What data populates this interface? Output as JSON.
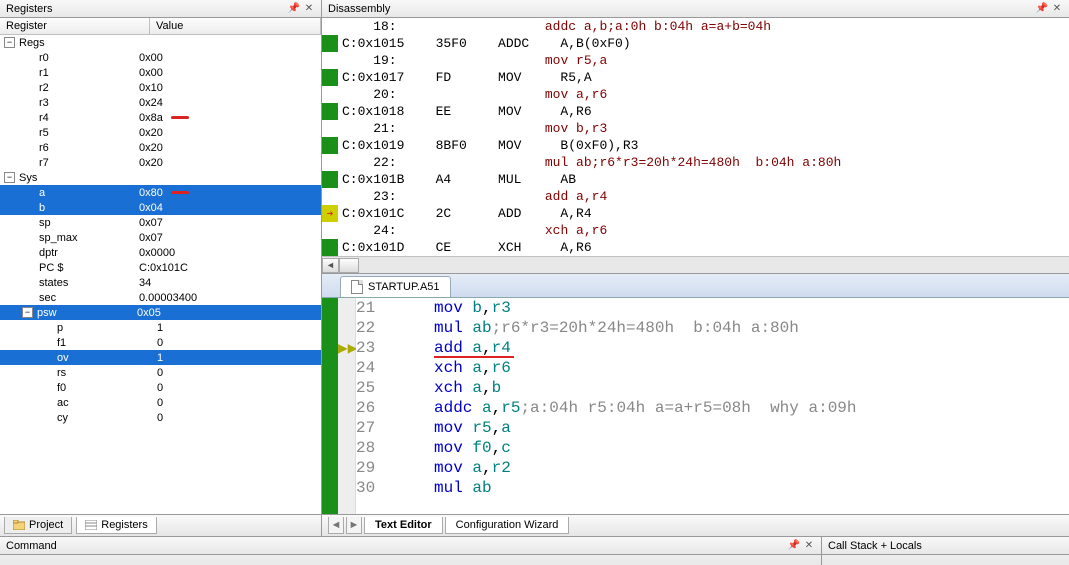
{
  "panels": {
    "registers_title": "Registers",
    "disassembly_title": "Disassembly",
    "command_title": "Command",
    "callstack_title": "Call Stack + Locals"
  },
  "reg_columns": {
    "name": "Register",
    "value": "Value"
  },
  "reg_tree": [
    {
      "type": "group",
      "label": "Regs",
      "expanded": true,
      "indent": 4,
      "children": [
        {
          "name": "r0",
          "value": "0x00"
        },
        {
          "name": "r1",
          "value": "0x00"
        },
        {
          "name": "r2",
          "value": "0x10"
        },
        {
          "name": "r3",
          "value": "0x24"
        },
        {
          "name": "r4",
          "value": "0x8a",
          "mark": true
        },
        {
          "name": "r5",
          "value": "0x20"
        },
        {
          "name": "r6",
          "value": "0x20"
        },
        {
          "name": "r7",
          "value": "0x20"
        }
      ]
    },
    {
      "type": "group",
      "label": "Sys",
      "expanded": true,
      "indent": 4,
      "children": [
        {
          "name": "a",
          "value": "0x80",
          "selected": true,
          "mark": true
        },
        {
          "name": "b",
          "value": "0x04",
          "selected": true
        },
        {
          "name": "sp",
          "value": "0x07"
        },
        {
          "name": "sp_max",
          "value": "0x07"
        },
        {
          "name": "dptr",
          "value": "0x0000"
        },
        {
          "name": "PC  $",
          "value": "C:0x101C"
        },
        {
          "name": "states",
          "value": "34"
        },
        {
          "name": "sec",
          "value": "0.00003400"
        },
        {
          "type": "group",
          "label": "psw",
          "value": "0x05",
          "expanded": true,
          "selected": true,
          "children": [
            {
              "name": "p",
              "value": "1"
            },
            {
              "name": "f1",
              "value": "0"
            },
            {
              "name": "ov",
              "value": "1",
              "selected": true
            },
            {
              "name": "rs",
              "value": "0"
            },
            {
              "name": "f0",
              "value": "0"
            },
            {
              "name": "ac",
              "value": "0"
            },
            {
              "name": "cy",
              "value": "0"
            }
          ]
        }
      ]
    }
  ],
  "left_tabs": {
    "project": "Project",
    "registers": "Registers"
  },
  "disassembly": [
    {
      "gutter": "",
      "indent": true,
      "ln": "    18:",
      "comment": "addc a,b;a:0h b:04h a=a+b=04h"
    },
    {
      "gutter": "green",
      "addr": "C:0x1015",
      "hex": "35F0",
      "mnem": "ADDC",
      "ops": "A,B(0xF0)"
    },
    {
      "gutter": "",
      "indent": true,
      "ln": "    19:",
      "comment": "mov r5,a"
    },
    {
      "gutter": "green",
      "addr": "C:0x1017",
      "hex": "FD",
      "mnem": "MOV",
      "ops": "R5,A"
    },
    {
      "gutter": "",
      "indent": true,
      "ln": "    20:",
      "comment": "mov a,r6"
    },
    {
      "gutter": "green",
      "addr": "C:0x1018",
      "hex": "EE",
      "mnem": "MOV",
      "ops": "A,R6"
    },
    {
      "gutter": "",
      "indent": true,
      "ln": "    21:",
      "comment": "mov b,r3"
    },
    {
      "gutter": "green",
      "addr": "C:0x1019",
      "hex": "8BF0",
      "mnem": "MOV",
      "ops": "B(0xF0),R3"
    },
    {
      "gutter": "",
      "indent": true,
      "ln": "    22:",
      "comment": "mul ab;r6*r3=20h*24h=480h  b:04h a:80h"
    },
    {
      "gutter": "green",
      "addr": "C:0x101B",
      "hex": "A4",
      "mnem": "MUL",
      "ops": "AB"
    },
    {
      "gutter": "",
      "indent": true,
      "ln": "    23:",
      "comment": "add a,r4"
    },
    {
      "gutter": "arrow",
      "addr": "C:0x101C",
      "hex": "2C",
      "mnem": "ADD",
      "ops": "A,R4"
    },
    {
      "gutter": "",
      "indent": true,
      "ln": "    24:",
      "comment": "xch a,r6"
    },
    {
      "gutter": "green",
      "addr": "C:0x101D",
      "hex": "CE",
      "mnem": "XCH",
      "ops": "A,R6"
    }
  ],
  "editor": {
    "tab_file": "STARTUP.A51",
    "bottom_tabs": {
      "text": "Text Editor",
      "config": "Configuration Wizard"
    },
    "lines": [
      {
        "n": 21,
        "code": [
          {
            "t": "mov ",
            "c": "blue"
          },
          {
            "t": "b",
            "c": "teal"
          },
          {
            "t": ",",
            "c": ""
          },
          {
            "t": "r3",
            "c": "teal"
          }
        ]
      },
      {
        "n": 22,
        "code": [
          {
            "t": "mul ",
            "c": "blue"
          },
          {
            "t": "ab",
            "c": "teal"
          },
          {
            "t": ";r6*r3=20h*24h=480h  b:04h a:80h",
            "c": "gray"
          }
        ]
      },
      {
        "n": 23,
        "current": true,
        "underline": true,
        "code": [
          {
            "t": "add ",
            "c": "blue"
          },
          {
            "t": "a",
            "c": "teal"
          },
          {
            "t": ",",
            "c": ""
          },
          {
            "t": "r4",
            "c": "teal"
          }
        ]
      },
      {
        "n": 24,
        "code": [
          {
            "t": "xch ",
            "c": "blue"
          },
          {
            "t": "a",
            "c": "teal"
          },
          {
            "t": ",",
            "c": ""
          },
          {
            "t": "r6",
            "c": "teal"
          }
        ]
      },
      {
        "n": 25,
        "code": [
          {
            "t": "xch ",
            "c": "blue"
          },
          {
            "t": "a",
            "c": "teal"
          },
          {
            "t": ",",
            "c": ""
          },
          {
            "t": "b",
            "c": "teal"
          }
        ]
      },
      {
        "n": 26,
        "code": [
          {
            "t": "addc ",
            "c": "blue"
          },
          {
            "t": "a",
            "c": "teal"
          },
          {
            "t": ",",
            "c": ""
          },
          {
            "t": "r5",
            "c": "teal"
          },
          {
            "t": ";a:04h r5:04h a=a+r5=08h  why a:09h",
            "c": "gray"
          }
        ]
      },
      {
        "n": 27,
        "code": [
          {
            "t": "mov ",
            "c": "blue"
          },
          {
            "t": "r5",
            "c": "teal"
          },
          {
            "t": ",",
            "c": ""
          },
          {
            "t": "a",
            "c": "teal"
          }
        ]
      },
      {
        "n": 28,
        "code": [
          {
            "t": "mov ",
            "c": "blue"
          },
          {
            "t": "f0",
            "c": "teal"
          },
          {
            "t": ",",
            "c": ""
          },
          {
            "t": "c",
            "c": "teal"
          }
        ]
      },
      {
        "n": 29,
        "code": [
          {
            "t": "mov ",
            "c": "blue"
          },
          {
            "t": "a",
            "c": "teal"
          },
          {
            "t": ",",
            "c": ""
          },
          {
            "t": "r2",
            "c": "teal"
          }
        ]
      },
      {
        "n": 30,
        "code": [
          {
            "t": "mul ",
            "c": "blue"
          },
          {
            "t": "ab",
            "c": "teal"
          }
        ]
      }
    ]
  }
}
